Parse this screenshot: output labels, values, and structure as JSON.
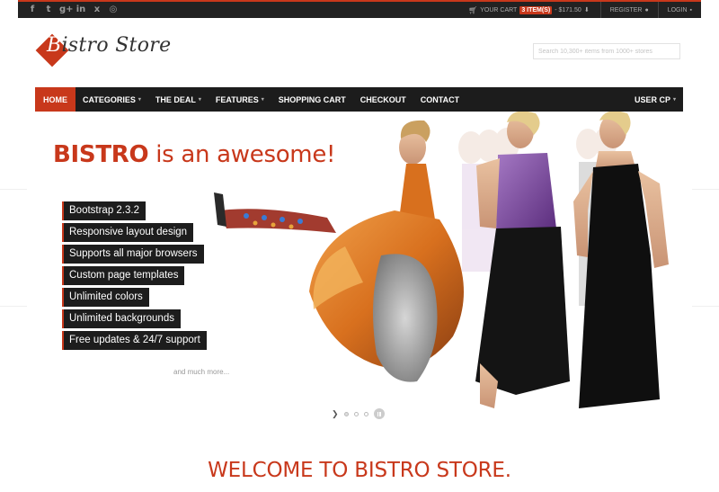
{
  "social_icons": [
    {
      "name": "facebook-icon",
      "glyph": "f"
    },
    {
      "name": "twitter-icon",
      "glyph": "t"
    },
    {
      "name": "google-plus-icon",
      "glyph": "g+"
    },
    {
      "name": "linkedin-icon",
      "glyph": "in"
    },
    {
      "name": "xing-icon",
      "glyph": "x"
    },
    {
      "name": "dribbble-icon",
      "glyph": "◎"
    }
  ],
  "topbar": {
    "cart_label": "YOUR CART",
    "cart_items": "3 ITEM(S)",
    "cart_total": "- $171.50",
    "register": "REGISTER",
    "login": "LOGIN"
  },
  "header": {
    "logo_first": "B",
    "logo_rest": "istro Store",
    "search_placeholder": "Search 10,300+ items from 1000+ stores"
  },
  "nav": {
    "items": [
      {
        "label": "HOME",
        "active": true,
        "dropdown": false
      },
      {
        "label": "CATEGORIES",
        "active": false,
        "dropdown": true
      },
      {
        "label": "THE DEAL",
        "active": false,
        "dropdown": true
      },
      {
        "label": "FEATURES",
        "active": false,
        "dropdown": true
      },
      {
        "label": "SHOPPING CART",
        "active": false,
        "dropdown": false
      },
      {
        "label": "CHECKOUT",
        "active": false,
        "dropdown": false
      },
      {
        "label": "CONTACT",
        "active": false,
        "dropdown": false
      }
    ],
    "user_cp": "USER CP"
  },
  "hero": {
    "title_strong": "BISTRO",
    "title_rest": " is an awesome!",
    "features": [
      "Bootstrap 2.3.2",
      "Responsive layout design",
      "Supports all major browsers",
      "Custom page templates",
      "Unlimited colors",
      "Unlimited backgrounds",
      "Free updates & 24/7 support"
    ],
    "more": "and much more...",
    "slide_count": 3,
    "active_slide": 1
  },
  "welcome": "WELCOME TO BISTRO STORE.",
  "colors": {
    "accent": "#c8381b",
    "dark": "#1c1c1c"
  }
}
